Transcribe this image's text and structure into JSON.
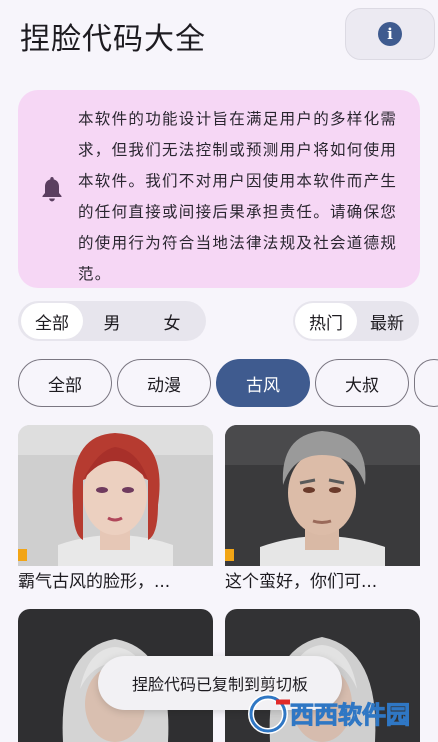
{
  "app": {
    "title": "捏脸代码大全"
  },
  "notice": {
    "lines": [
      "本软件的功能设计旨在满足用户的多样化需",
      "求，但我们无法控制或预测用户将如何使用",
      "本软件。我们不对用户因使用本软件而产生",
      "的任何直接或间接后果承担责任。请确保您",
      "的使用行为符合当地法律法规及社会道德规",
      "范。"
    ]
  },
  "gender_filter": {
    "options": [
      "全部",
      "男",
      "女"
    ],
    "selected": "全部"
  },
  "sort_filter": {
    "options": [
      "热门",
      "最新"
    ],
    "selected": "热门"
  },
  "categories": {
    "options": [
      "全部",
      "动漫",
      "古风",
      "大叔"
    ],
    "selected": "古风"
  },
  "cards": [
    {
      "caption": "霸气古风的脸形，..."
    },
    {
      "caption": "这个蛮好，你们可..."
    }
  ],
  "toast": "捏脸代码已复制到剪切板",
  "watermark": "西西软件园",
  "colors": {
    "accent": "#3f5b8f",
    "notice_bg": "#f6d7f5",
    "background": "#f7f5fb"
  },
  "icons": {
    "info": "info-icon",
    "notice": "bell-icon"
  }
}
